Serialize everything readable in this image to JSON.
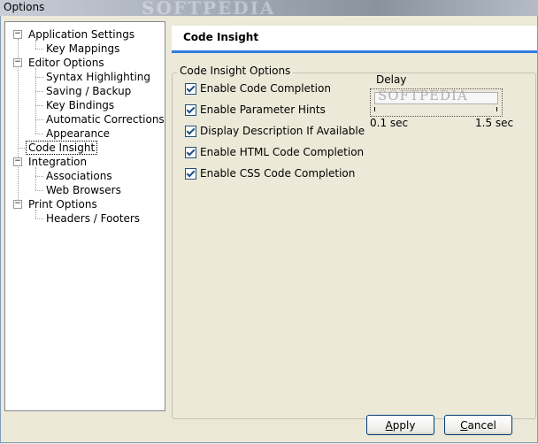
{
  "window": {
    "title": "Options",
    "watermark": "SOFTPEDIA"
  },
  "tree": {
    "items": [
      {
        "label": "Application Settings",
        "level": 0,
        "expander": "−"
      },
      {
        "label": "Key Mappings",
        "level": 1
      },
      {
        "label": "Editor Options",
        "level": 0,
        "expander": "−"
      },
      {
        "label": "Syntax Highlighting",
        "level": 1
      },
      {
        "label": "Saving / Backup",
        "level": 1
      },
      {
        "label": "Key Bindings",
        "level": 1
      },
      {
        "label": "Automatic Corrections",
        "level": 1
      },
      {
        "label": "Appearance",
        "level": 1
      },
      {
        "label": "Code Insight",
        "level": 0,
        "selected": true
      },
      {
        "label": "Integration",
        "level": 0,
        "expander": "−"
      },
      {
        "label": "Associations",
        "level": 1
      },
      {
        "label": "Web Browsers",
        "level": 1
      },
      {
        "label": "Print Options",
        "level": 0,
        "expander": "−"
      },
      {
        "label": "Headers / Footers",
        "level": 1
      }
    ]
  },
  "panel": {
    "header_title": "Code Insight",
    "group_title": "Code Insight Options",
    "options": [
      {
        "label": "Enable Code Completion",
        "checked": true
      },
      {
        "label": "Enable Parameter Hints",
        "checked": true
      },
      {
        "label": "Display Description If Available",
        "checked": true
      },
      {
        "label": "Enable HTML Code Completion",
        "checked": true
      },
      {
        "label": "Enable CSS Code Completion",
        "checked": true
      }
    ],
    "delay": {
      "label": "Delay",
      "min_label": "0.1 sec",
      "max_label": "1.5 sec",
      "watermark": "SOFTPEDIA"
    }
  },
  "buttons": {
    "apply_prefix": "",
    "apply_mnemonic": "A",
    "apply_rest": "pply",
    "cancel_prefix": "",
    "cancel_mnemonic": "C",
    "cancel_rest": "ancel"
  }
}
